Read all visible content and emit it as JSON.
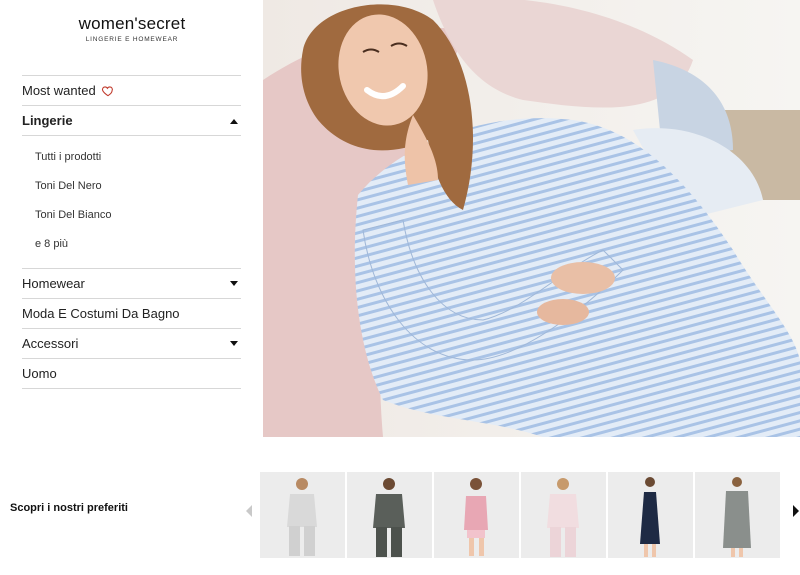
{
  "brand": {
    "name": "women'secret",
    "tagline": "LINGERIE E HOMEWEAR"
  },
  "nav": {
    "most_wanted": "Most wanted",
    "lingerie": "Lingerie",
    "lingerie_sub": [
      "Tutti i prodotti",
      "Toni Del Nero",
      "Toni Del Bianco",
      "e 8 più"
    ],
    "homewear": "Homewear",
    "moda": "Moda E Costumi Da Bagno",
    "accessori": "Accessori",
    "uomo": "Uomo"
  },
  "hero": {
    "image": "woman-in-blue-striped-pajamas"
  },
  "carousel": {
    "label": "Scopri i nostri preferiti",
    "items": [
      {
        "image": "light-grey-pajama-set",
        "color": "#d9d9d9"
      },
      {
        "image": "dark-grey-lounge-set",
        "color": "#5a5f5a"
      },
      {
        "image": "pink-camisole-shorts",
        "color": "#e8a7b4"
      },
      {
        "image": "pale-pink-pajama-set",
        "color": "#f1dde0"
      },
      {
        "image": "navy-slip-dress",
        "color": "#1e2a44"
      },
      {
        "image": "grey-robe",
        "color": "#8a8f8c"
      }
    ]
  },
  "colors": {
    "divider": "#d7d7d7",
    "heart": "#c0392b",
    "text": "#222222"
  }
}
